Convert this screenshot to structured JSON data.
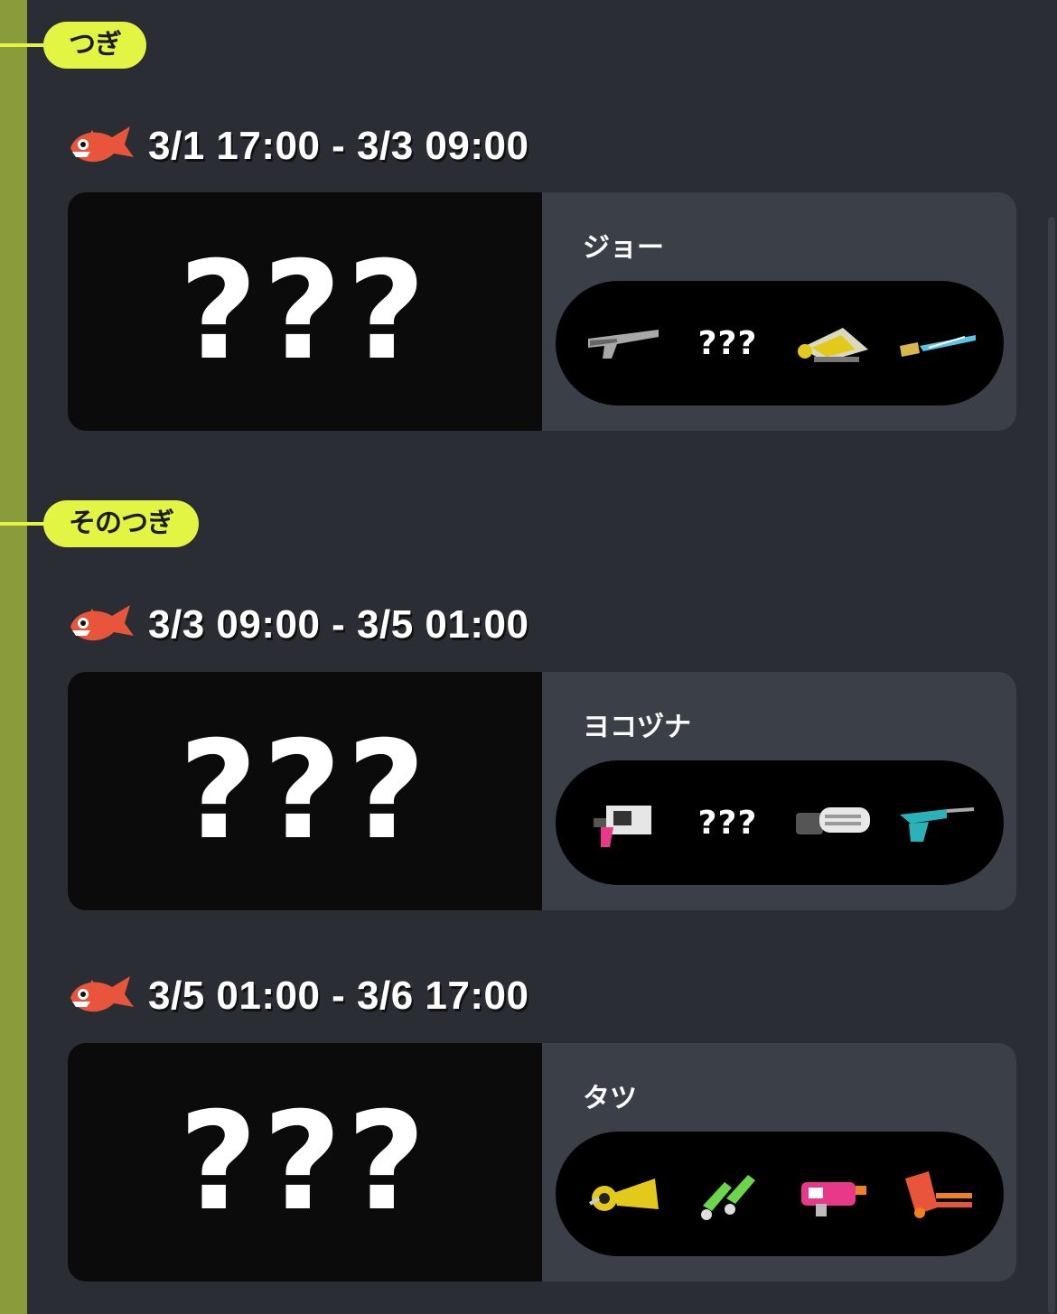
{
  "sections": [
    {
      "tag": "つぎ",
      "shifts": [
        {
          "time": "3/1 17:00 - 3/3 09:00",
          "stage_image_text": "???",
          "boss": "ジョー",
          "weapons": [
            {
              "type": "icon",
              "icon": "rifle-gray-weapon-icon"
            },
            {
              "type": "random",
              "label": "???"
            },
            {
              "type": "icon",
              "icon": "yellow-slosher-weapon-icon"
            },
            {
              "type": "icon",
              "icon": "blue-bow-weapon-icon"
            }
          ]
        }
      ]
    },
    {
      "tag": "そのつぎ",
      "shifts": [
        {
          "time": "3/3 09:00 - 3/5 01:00",
          "stage_image_text": "???",
          "boss": "ヨコヅナ",
          "weapons": [
            {
              "type": "icon",
              "icon": "pink-blaster-weapon-icon"
            },
            {
              "type": "random",
              "label": "???"
            },
            {
              "type": "icon",
              "icon": "white-splatling-weapon-icon"
            },
            {
              "type": "icon",
              "icon": "teal-charger-weapon-icon"
            }
          ]
        },
        {
          "time": "3/5 01:00 - 3/6 17:00",
          "stage_image_text": "???",
          "boss": "タツ",
          "weapons": [
            {
              "type": "icon",
              "icon": "yellow-roller-weapon-icon"
            },
            {
              "type": "icon",
              "icon": "green-dualies-weapon-icon"
            },
            {
              "type": "icon",
              "icon": "pink-shooter-weapon-icon"
            },
            {
              "type": "icon",
              "icon": "orange-spinner-weapon-icon"
            }
          ]
        }
      ]
    }
  ],
  "colors": {
    "background": "#2a2d34",
    "rail": "#8a9b3c",
    "tag": "#e2f542",
    "salmon": "#e9553a",
    "card": "#3a3f48"
  }
}
